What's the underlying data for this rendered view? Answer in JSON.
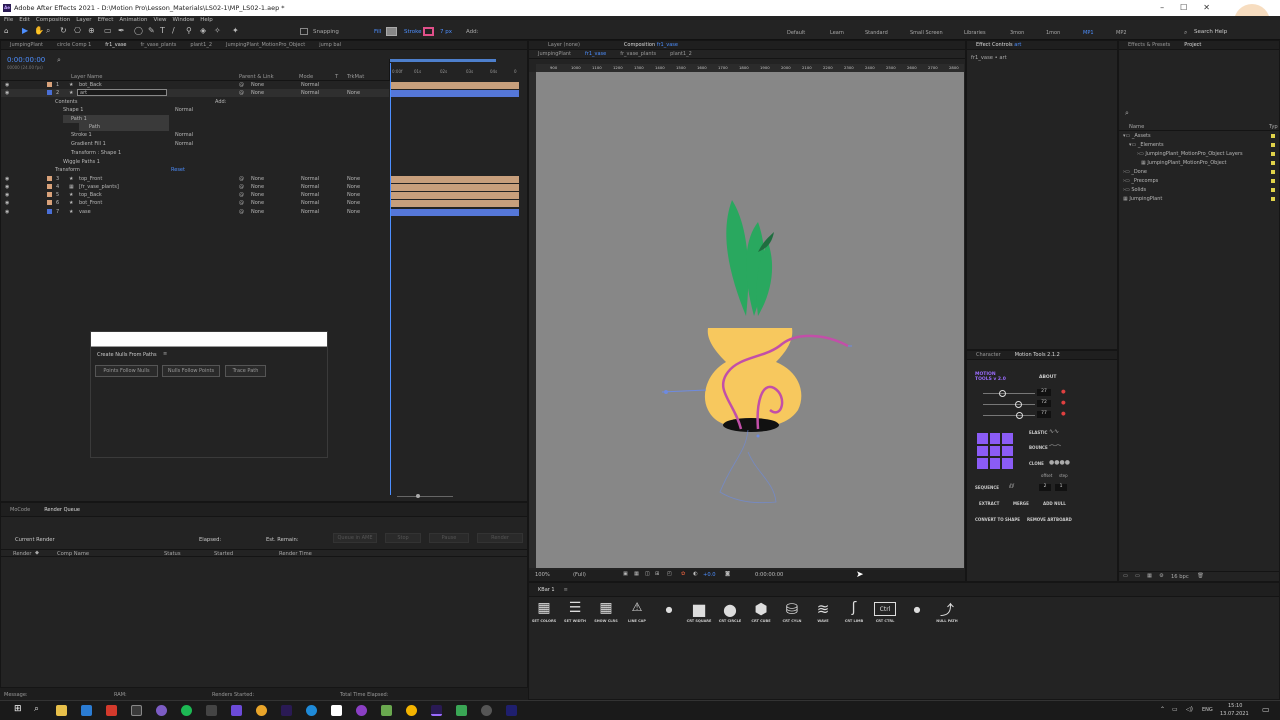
{
  "window": {
    "title": "Adobe After Effects 2021 - D:\\Motion Pro\\Lesson_Materials\\LS02-1\\MP_LS02-1.aep *"
  },
  "menu": [
    "File",
    "Edit",
    "Composition",
    "Layer",
    "Effect",
    "Animation",
    "View",
    "Window",
    "Help"
  ],
  "toolbar": {
    "snapping": "Snapping",
    "fill": "Fill",
    "stroke": "Stroke",
    "stroke_px": "7 px",
    "add": "Add:",
    "search_help": "Search Help",
    "workspaces": [
      "Default",
      "Learn",
      "Standard",
      "Small Screen",
      "Libraries",
      "3mon",
      "1mon",
      "MP1",
      "MP2"
    ],
    "active_workspace": "MP1"
  },
  "timeline": {
    "tabs": [
      "JumpingPlant",
      "circle Comp 1",
      "fr1_vase",
      "fr_vase_plants",
      "plant1_2",
      "JumpingPlant_MotionPro_Object",
      "jump bal"
    ],
    "active_tab": "fr1_vase",
    "timecode": "0:00:00:00",
    "timecode_sub": "00000 (24.00 fps)",
    "columns": {
      "layer_name": "Layer Name",
      "parent": "Parent & Link",
      "mode": "Mode",
      "t": "T",
      "trkmat": "TrkMat"
    },
    "ruler": [
      "0:00f",
      "01s",
      "02s",
      "03s",
      "04s",
      "0"
    ],
    "layers": [
      {
        "num": "1",
        "name": "bot_Back",
        "parent": "None",
        "mode": "Normal",
        "trkmat": "",
        "color": "#d9a27a"
      },
      {
        "num": "2",
        "name": "art",
        "parent": "None",
        "mode": "Normal",
        "trkmat": "None",
        "color": "#4a6fd6"
      },
      {
        "num": "3",
        "name": "top_Front",
        "parent": "None",
        "mode": "Normal",
        "trkmat": "None",
        "color": "#d9a27a"
      },
      {
        "num": "4",
        "name": "[fr_vase_plants]",
        "parent": "None",
        "mode": "Normal",
        "trkmat": "None",
        "color": "#d9a27a"
      },
      {
        "num": "5",
        "name": "top_Back",
        "parent": "None",
        "mode": "Normal",
        "trkmat": "None",
        "color": "#d9a27a"
      },
      {
        "num": "6",
        "name": "bot_Front",
        "parent": "None",
        "mode": "Normal",
        "trkmat": "None",
        "color": "#d9a27a"
      },
      {
        "num": "7",
        "name": "vase",
        "parent": "None",
        "mode": "Normal",
        "trkmat": "None",
        "color": "#4a6fd6"
      }
    ],
    "props": {
      "contents": "Contents",
      "add": "Add:",
      "shape1": "Shape 1",
      "shape1_mode": "Normal",
      "path1": "Path 1",
      "path": "Path",
      "stroke1": "Stroke 1",
      "stroke1_mode": "Normal",
      "gradient": "Gradient Fill 1",
      "gradient_mode": "Normal",
      "transform_shape": "Transform : Shape 1",
      "wiggle": "Wiggle Paths 1",
      "transform": "Transform",
      "reset": "Reset"
    }
  },
  "create_nulls": {
    "title": "Create Nulls From Paths",
    "buttons": [
      "Points Follow Nulls",
      "Nulls Follow Points",
      "Trace Path"
    ]
  },
  "render_queue": {
    "tabs": [
      "MoCode",
      "Render Queue"
    ],
    "current_render": "Current Render",
    "elapsed": "Elapsed:",
    "remain": "Est. Remain:",
    "queue_btn": "Queue in AME",
    "stop": "Stop",
    "pause": "Pause",
    "render": "Render",
    "cols": [
      "Render",
      "Comp Name",
      "Status",
      "Started",
      "Render Time"
    ]
  },
  "status": {
    "message": "Message:",
    "ram": "RAM:",
    "renders_started": "Renders Started:",
    "total_time": "Total Time Elapsed:"
  },
  "viewer": {
    "layer_tab": "Layer (none)",
    "comp_tab": "Composition",
    "comp_name": "fr1_vase",
    "breadcrumbs": [
      "JumpingPlant",
      "fr1_vase",
      "fr_vase_plants",
      "plant1_2"
    ],
    "ruler": [
      "900",
      "1000",
      "1100",
      "1200",
      "1300",
      "1400",
      "1500",
      "1600",
      "1700",
      "1800",
      "1900",
      "2000",
      "2100",
      "2200",
      "2300",
      "2400",
      "2500",
      "2600",
      "2700",
      "2800"
    ],
    "zoom": "100%",
    "quality": "(Full)",
    "exposure": "+0.0",
    "timecode": "0:00:00:00"
  },
  "effect_controls": {
    "tab": "Effect Controls",
    "layer": "art",
    "path": "fr1_vase • art"
  },
  "project": {
    "tabs": [
      "Effects & Presets",
      "Project"
    ],
    "col_name": "Name",
    "col_type": "Typ",
    "items": [
      "_Assets",
      "_Elements",
      "JumpingPlant_MotionPro_Object Layers",
      "JumpingPlant_MotionPro_Object",
      "_Done",
      "_Precomps",
      "Solids",
      "JumpingPlant"
    ],
    "fps": "16 bpc"
  },
  "motion_tools": {
    "tabs": [
      "Character",
      "Motion Tools 2.1.2"
    ],
    "logo_line1": "MOTION",
    "logo_line2": "TOOLS v 2.0",
    "about": "ABOUT",
    "values": [
      "27",
      "72",
      "77"
    ],
    "elastic": "ELASTIC",
    "bounce": "BOUNCE",
    "clone": "CLONE",
    "offset": "offset",
    "step": "step",
    "sequence": "SEQUENCE",
    "seq_values": [
      "2",
      "1"
    ],
    "extract": "EXTRACT",
    "merge": "MERGE",
    "add_null": "ADD NULL",
    "convert": "CONVERT TO SHAPE",
    "remove": "REMOVE ARTBOARD"
  },
  "kbar": {
    "title": "KBar 1",
    "buttons": [
      "SET COLORS",
      "SET WIDTH",
      "SHOW CLRS",
      "LINE CAP",
      "CRT SQUARE",
      "CRT CIRCLE",
      "CRT CUBE",
      "CRT CYLN",
      "WAVE",
      "CRT LIMB",
      "CRT CTRL",
      "NULL PATH"
    ],
    "ctrl": "Ctrl"
  },
  "taskbar": {
    "lang": "ENG",
    "time": "15:10",
    "date": "13.07.2021"
  },
  "colors": {
    "accent": "#4d8fff",
    "vase": "#f7c85e",
    "leaf": "#29a85f",
    "path": "#c24fa8",
    "purple": "#8b5cf6"
  }
}
